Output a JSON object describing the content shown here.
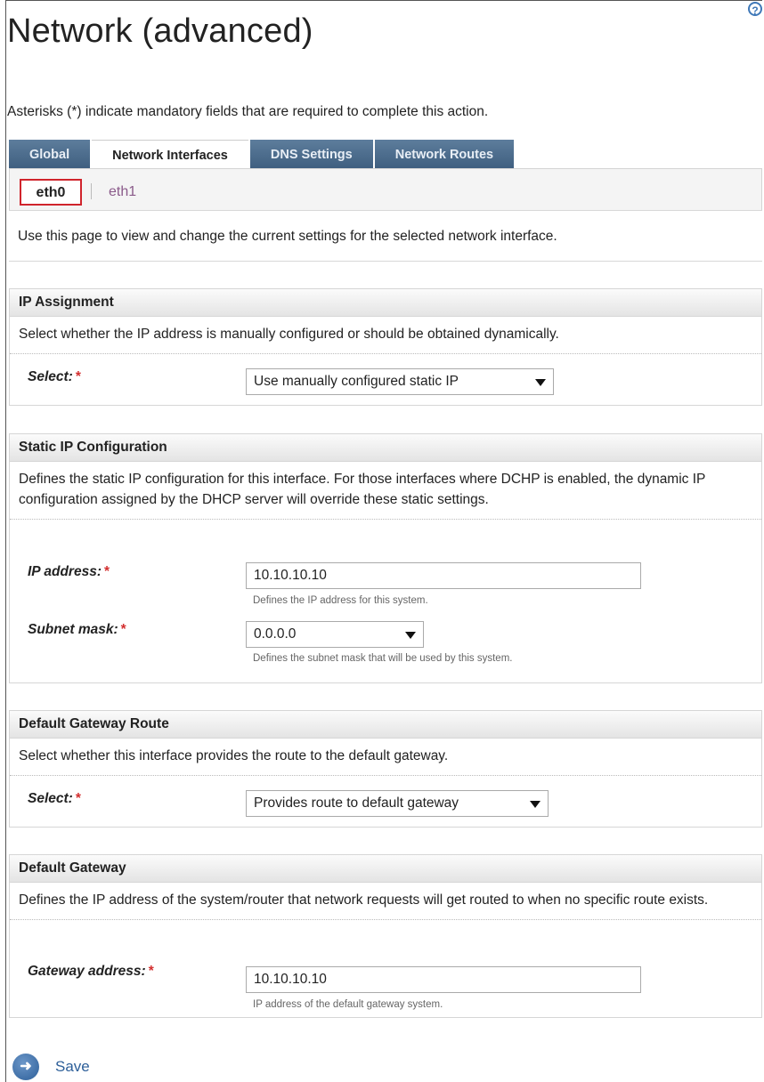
{
  "page": {
    "title": "Network (advanced)",
    "help_icon": "?",
    "intro": "Asterisks (*) indicate mandatory fields that are required to complete this action."
  },
  "tabs": [
    "Global",
    "Network Interfaces",
    "DNS Settings",
    "Network Routes"
  ],
  "active_tab": "Network Interfaces",
  "interfaces": {
    "selected": "eth0",
    "other": "eth1"
  },
  "top_description": "Use this page to view and change the current settings for the selected network interface.",
  "ip_assignment": {
    "heading": "IP Assignment",
    "description": "Select whether the IP address is manually configured or should be obtained dynamically.",
    "select_label": "Select:",
    "select_value": "Use manually configured static IP"
  },
  "static_ip": {
    "heading": "Static IP Configuration",
    "description": "Defines the static IP configuration for this interface. For those interfaces where DCHP is enabled, the dynamic IP configuration assigned by the DHCP server will override these static settings.",
    "ip_label": "IP address:",
    "ip_value": "10.10.10.10",
    "ip_hint": "Defines the IP address for this system.",
    "mask_label": "Subnet mask:",
    "mask_value": "0.0.0.0",
    "mask_hint": "Defines the subnet mask that will be used by this system."
  },
  "gateway_route": {
    "heading": "Default Gateway Route",
    "description": "Select whether this interface provides the route to the default gateway.",
    "select_label": "Select:",
    "select_value": "Provides route to default gateway"
  },
  "gateway": {
    "heading": "Default Gateway",
    "description": "Defines the IP address of the system/router that network requests will get routed to when no specific route exists.",
    "address_label": "Gateway address:",
    "address_value": "10.10.10.10",
    "address_hint": "IP address of the default gateway system."
  },
  "required_marker": "*",
  "save_label": "Save",
  "icons": {
    "help": "help-icon",
    "save": "arrow-right-circle-icon",
    "dropdown": "chevron-down-icon"
  }
}
